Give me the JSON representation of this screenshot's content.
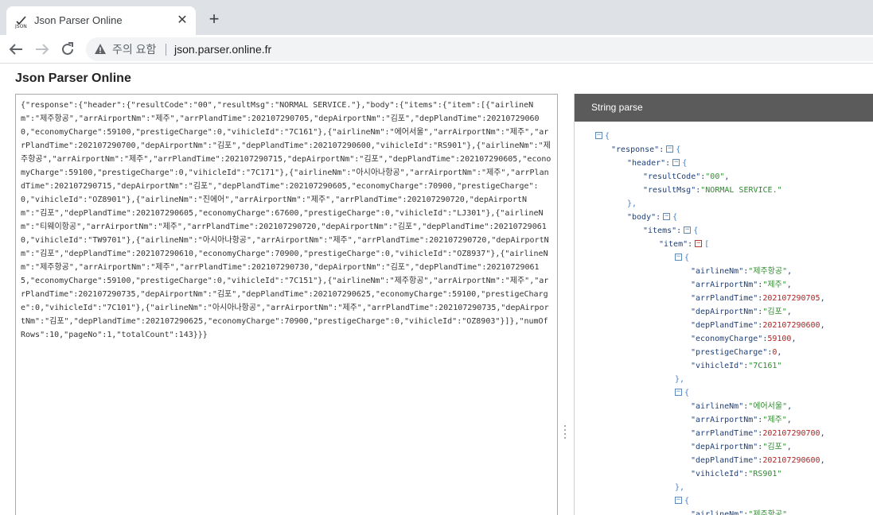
{
  "browser": {
    "tab_title": "Json Parser Online",
    "new_tab_symbol": "+",
    "close_symbol": "✕",
    "security_warning": "주의 요함",
    "url": "json.parser.online.fr"
  },
  "page": {
    "title": "Json Parser Online"
  },
  "editor": {
    "content": "{\"response\":{\"header\":{\"resultCode\":\"00\",\"resultMsg\":\"NORMAL SERVICE.\"},\"body\":{\"items\":{\"item\":[{\"airlineNm\":\"제주항공\",\"arrAirportNm\":\"제주\",\"arrPlandTime\":202107290705,\"depAirportNm\":\"김포\",\"depPlandTime\":202107290600,\"economyCharge\":59100,\"prestigeCharge\":0,\"vihicleId\":\"7C161\"},{\"airlineNm\":\"에어서울\",\"arrAirportNm\":\"제주\",\"arrPlandTime\":202107290700,\"depAirportNm\":\"김포\",\"depPlandTime\":202107290600,\"vihicleId\":\"RS901\"},{\"airlineNm\":\"제주항공\",\"arrAirportNm\":\"제주\",\"arrPlandTime\":202107290715,\"depAirportNm\":\"김포\",\"depPlandTime\":202107290605,\"economyCharge\":59100,\"prestigeCharge\":0,\"vihicleId\":\"7C171\"},{\"airlineNm\":\"아시아나항공\",\"arrAirportNm\":\"제주\",\"arrPlandTime\":202107290715,\"depAirportNm\":\"김포\",\"depPlandTime\":202107290605,\"economyCharge\":70900,\"prestigeCharge\":0,\"vihicleId\":\"OZ8901\"},{\"airlineNm\":\"진에어\",\"arrAirportNm\":\"제주\",\"arrPlandTime\":202107290720,\"depAirportNm\":\"김포\",\"depPlandTime\":202107290605,\"economyCharge\":67600,\"prestigeCharge\":0,\"vihicleId\":\"LJ301\"},{\"airlineNm\":\"티웨이항공\",\"arrAirportNm\":\"제주\",\"arrPlandTime\":202107290720,\"depAirportNm\":\"김포\",\"depPlandTime\":202107290610,\"vihicleId\":\"TW9701\"},{\"airlineNm\":\"아시아나항공\",\"arrAirportNm\":\"제주\",\"arrPlandTime\":202107290720,\"depAirportNm\":\"김포\",\"depPlandTime\":202107290610,\"economyCharge\":70900,\"prestigeCharge\":0,\"vihicleId\":\"OZ8937\"},{\"airlineNm\":\"제주항공\",\"arrAirportNm\":\"제주\",\"arrPlandTime\":202107290730,\"depAirportNm\":\"김포\",\"depPlandTime\":202107290615,\"economyCharge\":59100,\"prestigeCharge\":0,\"vihicleId\":\"7C151\"},{\"airlineNm\":\"제주항공\",\"arrAirportNm\":\"제주\",\"arrPlandTime\":202107290735,\"depAirportNm\":\"김포\",\"depPlandTime\":202107290625,\"economyCharge\":59100,\"prestigeCharge\":0,\"vihicleId\":\"7C101\"},{\"airlineNm\":\"아시아나항공\",\"arrAirportNm\":\"제주\",\"arrPlandTime\":202107290735,\"depAirportNm\":\"김포\",\"depPlandTime\":202107290625,\"economyCharge\":70900,\"prestigeCharge\":0,\"vihicleId\":\"OZ8903\"}]},\"numOfRows\":10,\"pageNo\":1,\"totalCount\":143}}}"
  },
  "viewer": {
    "header": "String parse",
    "tree": [
      {
        "indent": 0,
        "toggle": "minus",
        "tokens": [
          {
            "t": "{",
            "c": "br"
          }
        ]
      },
      {
        "indent": 1,
        "tokens": [
          {
            "t": "\"response\"",
            "c": "k"
          },
          {
            "t": ":",
            "c": "p"
          },
          {
            "t": "⊟",
            "c": "tog"
          },
          {
            "t": "{",
            "c": "br"
          }
        ]
      },
      {
        "indent": 2,
        "tokens": [
          {
            "t": "\"header\"",
            "c": "k"
          },
          {
            "t": ":",
            "c": "p"
          },
          {
            "t": "⊟",
            "c": "tog"
          },
          {
            "t": "{",
            "c": "br"
          }
        ]
      },
      {
        "indent": 3,
        "tokens": [
          {
            "t": "\"resultCode\"",
            "c": "k"
          },
          {
            "t": ":",
            "c": "p"
          },
          {
            "t": "\"00\"",
            "c": "s"
          },
          {
            "t": ",",
            "c": "p"
          }
        ]
      },
      {
        "indent": 3,
        "tokens": [
          {
            "t": "\"resultMsg\"",
            "c": "k"
          },
          {
            "t": ":",
            "c": "p"
          },
          {
            "t": "\"NORMAL SERVICE.\"",
            "c": "s"
          }
        ]
      },
      {
        "indent": 2,
        "tokens": [
          {
            "t": "},",
            "c": "br"
          }
        ]
      },
      {
        "indent": 2,
        "tokens": [
          {
            "t": "\"body\"",
            "c": "k"
          },
          {
            "t": ":",
            "c": "p"
          },
          {
            "t": "⊟",
            "c": "tog"
          },
          {
            "t": "{",
            "c": "br"
          }
        ]
      },
      {
        "indent": 3,
        "tokens": [
          {
            "t": "\"items\"",
            "c": "k"
          },
          {
            "t": ":",
            "c": "p"
          },
          {
            "t": "⊟",
            "c": "tog"
          },
          {
            "t": "{",
            "c": "br"
          }
        ]
      },
      {
        "indent": 4,
        "tokens": [
          {
            "t": "\"item\"",
            "c": "k"
          },
          {
            "t": ":",
            "c": "p"
          },
          {
            "t": "⊟",
            "c": "togred"
          },
          {
            "t": "[",
            "c": "br"
          }
        ]
      },
      {
        "indent": 5,
        "toggle": "minus",
        "tokens": [
          {
            "t": "{",
            "c": "br"
          }
        ]
      },
      {
        "indent": 6,
        "tokens": [
          {
            "t": "\"airlineNm\"",
            "c": "k"
          },
          {
            "t": ":",
            "c": "p"
          },
          {
            "t": "\"제주항공\"",
            "c": "s"
          },
          {
            "t": ",",
            "c": "p"
          }
        ]
      },
      {
        "indent": 6,
        "tokens": [
          {
            "t": "\"arrAirportNm\"",
            "c": "k"
          },
          {
            "t": ":",
            "c": "p"
          },
          {
            "t": "\"제주\"",
            "c": "s"
          },
          {
            "t": ",",
            "c": "p"
          }
        ]
      },
      {
        "indent": 6,
        "tokens": [
          {
            "t": "\"arrPlandTime\"",
            "c": "k"
          },
          {
            "t": ":",
            "c": "p"
          },
          {
            "t": "202107290705",
            "c": "n"
          },
          {
            "t": ",",
            "c": "p"
          }
        ]
      },
      {
        "indent": 6,
        "tokens": [
          {
            "t": "\"depAirportNm\"",
            "c": "k"
          },
          {
            "t": ":",
            "c": "p"
          },
          {
            "t": "\"김포\"",
            "c": "s"
          },
          {
            "t": ",",
            "c": "p"
          }
        ]
      },
      {
        "indent": 6,
        "tokens": [
          {
            "t": "\"depPlandTime\"",
            "c": "k"
          },
          {
            "t": ":",
            "c": "p"
          },
          {
            "t": "202107290600",
            "c": "n"
          },
          {
            "t": ",",
            "c": "p"
          }
        ]
      },
      {
        "indent": 6,
        "tokens": [
          {
            "t": "\"economyCharge\"",
            "c": "k"
          },
          {
            "t": ":",
            "c": "p"
          },
          {
            "t": "59100",
            "c": "n"
          },
          {
            "t": ",",
            "c": "p"
          }
        ]
      },
      {
        "indent": 6,
        "tokens": [
          {
            "t": "\"prestigeCharge\"",
            "c": "k"
          },
          {
            "t": ":",
            "c": "p"
          },
          {
            "t": "0",
            "c": "n"
          },
          {
            "t": ",",
            "c": "p"
          }
        ]
      },
      {
        "indent": 6,
        "tokens": [
          {
            "t": "\"vihicleId\"",
            "c": "k"
          },
          {
            "t": ":",
            "c": "p"
          },
          {
            "t": "\"7C161\"",
            "c": "s"
          }
        ]
      },
      {
        "indent": 5,
        "tokens": [
          {
            "t": "},",
            "c": "br"
          }
        ]
      },
      {
        "indent": 5,
        "toggle": "minus",
        "tokens": [
          {
            "t": "{",
            "c": "br"
          }
        ]
      },
      {
        "indent": 6,
        "tokens": [
          {
            "t": "\"airlineNm\"",
            "c": "k"
          },
          {
            "t": ":",
            "c": "p"
          },
          {
            "t": "\"에어서울\"",
            "c": "s"
          },
          {
            "t": ",",
            "c": "p"
          }
        ]
      },
      {
        "indent": 6,
        "tokens": [
          {
            "t": "\"arrAirportNm\"",
            "c": "k"
          },
          {
            "t": ":",
            "c": "p"
          },
          {
            "t": "\"제주\"",
            "c": "s"
          },
          {
            "t": ",",
            "c": "p"
          }
        ]
      },
      {
        "indent": 6,
        "tokens": [
          {
            "t": "\"arrPlandTime\"",
            "c": "k"
          },
          {
            "t": ":",
            "c": "p"
          },
          {
            "t": "202107290700",
            "c": "n"
          },
          {
            "t": ",",
            "c": "p"
          }
        ]
      },
      {
        "indent": 6,
        "tokens": [
          {
            "t": "\"depAirportNm\"",
            "c": "k"
          },
          {
            "t": ":",
            "c": "p"
          },
          {
            "t": "\"김포\"",
            "c": "s"
          },
          {
            "t": ",",
            "c": "p"
          }
        ]
      },
      {
        "indent": 6,
        "tokens": [
          {
            "t": "\"depPlandTime\"",
            "c": "k"
          },
          {
            "t": ":",
            "c": "p"
          },
          {
            "t": "202107290600",
            "c": "n"
          },
          {
            "t": ",",
            "c": "p"
          }
        ]
      },
      {
        "indent": 6,
        "tokens": [
          {
            "t": "\"vihicleId\"",
            "c": "k"
          },
          {
            "t": ":",
            "c": "p"
          },
          {
            "t": "\"RS901\"",
            "c": "s"
          }
        ]
      },
      {
        "indent": 5,
        "tokens": [
          {
            "t": "},",
            "c": "br"
          }
        ]
      },
      {
        "indent": 5,
        "toggle": "minus",
        "tokens": [
          {
            "t": "{",
            "c": "br"
          }
        ]
      },
      {
        "indent": 6,
        "tokens": [
          {
            "t": "\"airlineNm\"",
            "c": "k"
          },
          {
            "t": ":",
            "c": "p"
          },
          {
            "t": "\"제주항공\"",
            "c": "s"
          },
          {
            "t": ",",
            "c": "p"
          }
        ]
      }
    ]
  },
  "colors": {
    "tabstrip": "#dee1e6",
    "viewer_header": "#5b5b5b",
    "json_key": "#1f3f77",
    "json_string": "#2e8b2e",
    "json_number": "#b22222",
    "json_bracket": "#4a7fbf",
    "toggle_array": "#c0392b"
  }
}
